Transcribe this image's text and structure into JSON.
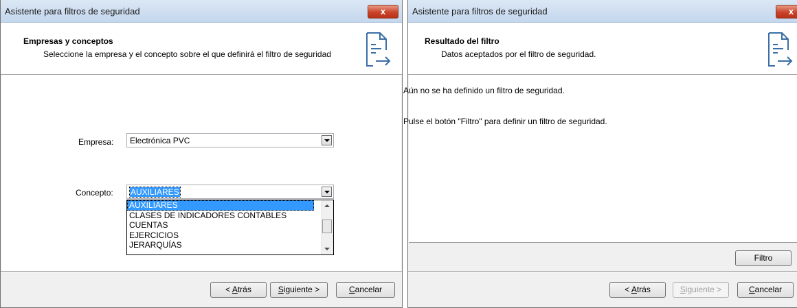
{
  "left_window": {
    "title": "Asistente para filtros de seguridad",
    "close_label": "x",
    "header": {
      "title": "Empresas y conceptos",
      "subtitle": "Seleccione la empresa y el concepto sobre el que definirá el filtro de seguridad"
    },
    "empresa": {
      "label": "Empresa:",
      "value": "Electrónica PVC"
    },
    "concepto": {
      "label": "Concepto:",
      "value": "AUXILIARES",
      "options": [
        "AUXILIARES",
        "CLASES DE INDICADORES CONTABLES",
        "CUENTAS",
        "EJERCICIOS",
        "JERARQUÍAS"
      ]
    },
    "buttons": {
      "back_pre": "< ",
      "back_key": "A",
      "back_rest": "trás",
      "next_key": "S",
      "next_rest": "iguiente >",
      "cancel_key": "C",
      "cancel_rest": "ancelar"
    }
  },
  "right_window": {
    "title": "Asistente para filtros de seguridad",
    "close_label": "x",
    "header": {
      "title": "Resultado del filtro",
      "subtitle": "Datos aceptados por el filtro de seguridad."
    },
    "messages": [
      "Aún no se ha definido un filtro de seguridad.",
      "Pulse el botón \"Filtro\" para definir un filtro de seguridad."
    ],
    "filter_button": "Filtro",
    "buttons": {
      "back_pre": "< ",
      "back_key": "A",
      "back_rest": "trás",
      "next_key": "S",
      "next_rest": "iguiente >",
      "cancel_key": "C",
      "cancel_rest": "ancelar"
    }
  },
  "colors": {
    "selection": "#3399ff",
    "close": "#c8442a",
    "icon": "#3a6ea5"
  }
}
